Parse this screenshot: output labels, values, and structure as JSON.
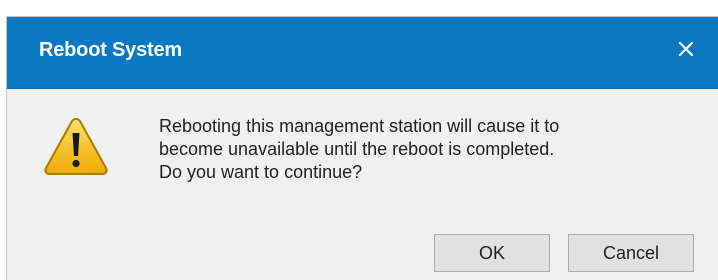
{
  "dialog": {
    "title": "Reboot System",
    "close_icon": "close-icon",
    "warning_icon": "warning-icon",
    "message_lines": [
      "Rebooting this management station will cause it to",
      "become unavailable until the reboot is completed.",
      "Do you want to continue?"
    ],
    "buttons": {
      "ok_label": "OK",
      "cancel_label": "Cancel"
    }
  },
  "colors": {
    "titlebar": "#0a77c2",
    "dialog_background": "#f0f0f0",
    "button_background": "#e1e1e1",
    "warning_yellow": "#f6c219",
    "warning_border": "#b07a00"
  }
}
